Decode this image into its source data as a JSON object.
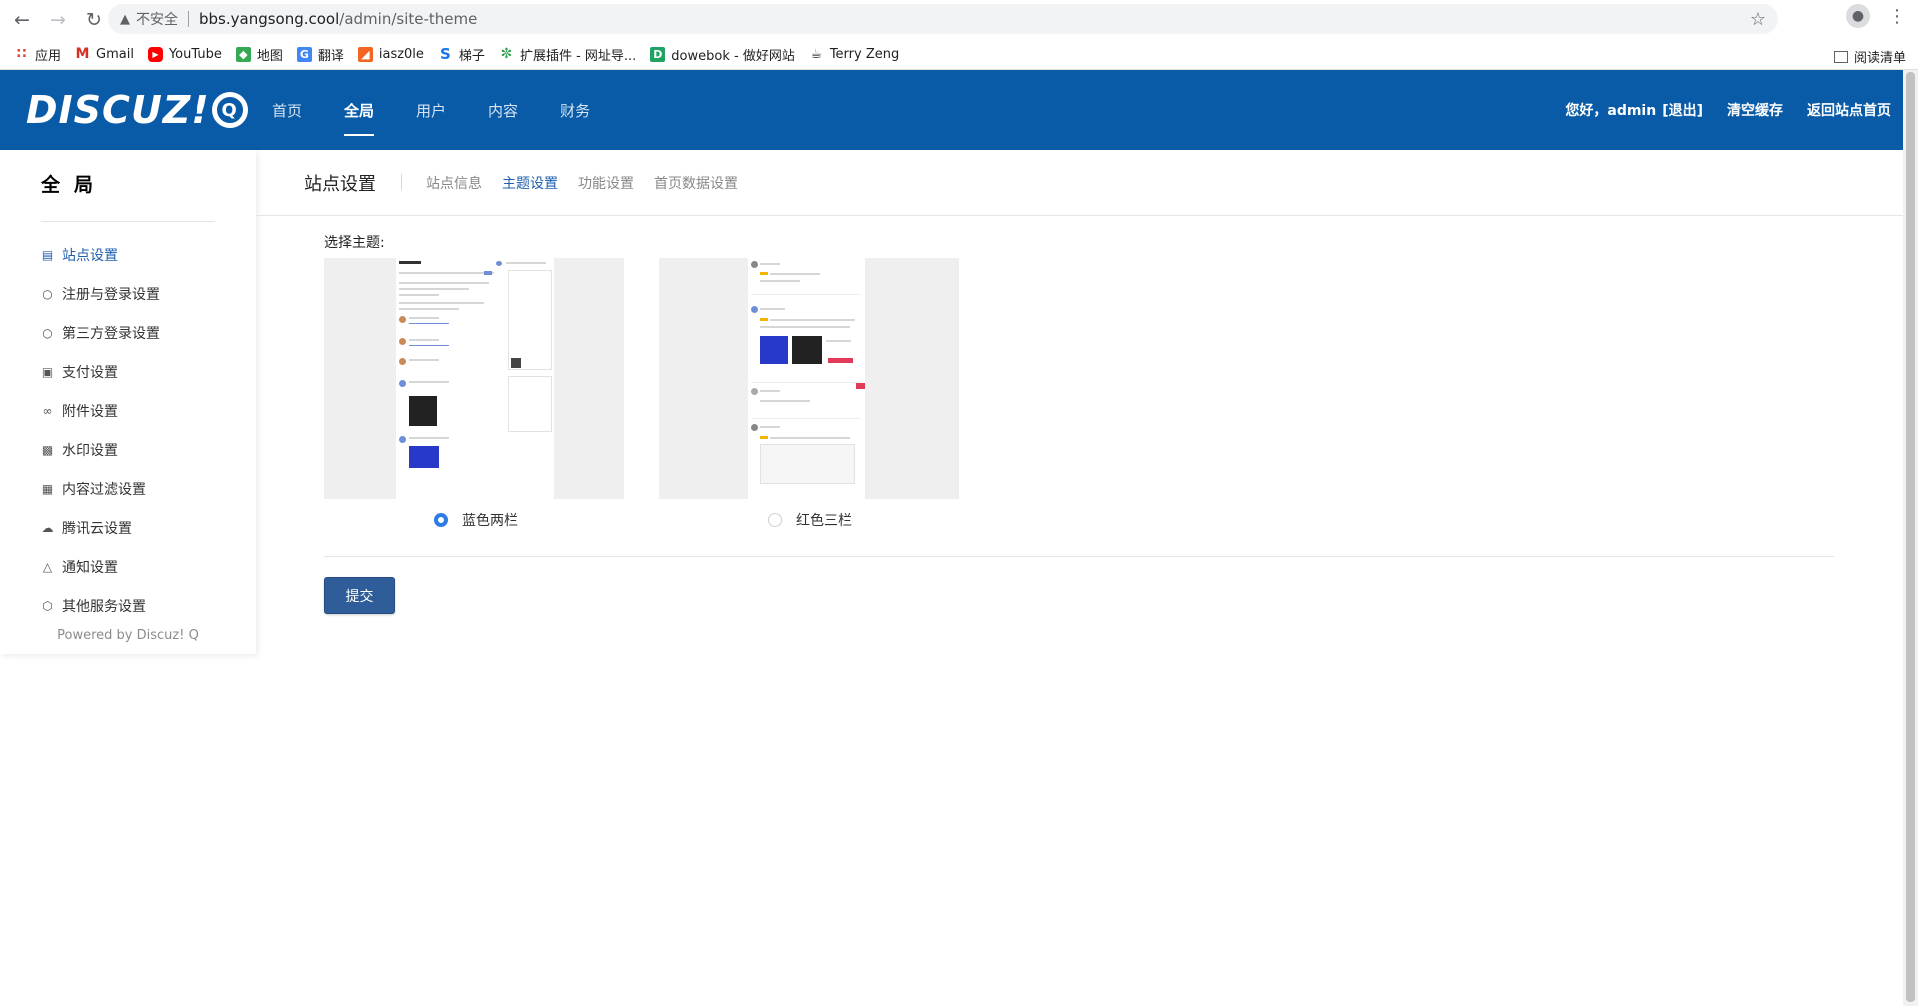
{
  "browser": {
    "insecure_label": "不安全",
    "url_host": "bbs.yangsong.cool",
    "url_path": "/admin/site-theme",
    "bookmarks": [
      {
        "label": "应用",
        "icon": "apps-grid-icon",
        "color": "#e94235"
      },
      {
        "label": "Gmail",
        "icon": "gmail-icon",
        "color": "#d93025"
      },
      {
        "label": "YouTube",
        "icon": "youtube-icon",
        "color": "#ff0000"
      },
      {
        "label": "地图",
        "icon": "maps-icon",
        "color": "#34a853"
      },
      {
        "label": "翻译",
        "icon": "translate-icon",
        "color": "#4285f4"
      },
      {
        "label": "iasz0le",
        "icon": "bookmark-orange-icon",
        "color": "#f26522"
      },
      {
        "label": "梯子",
        "icon": "s-logo-icon",
        "color": "#1a73e8"
      },
      {
        "label": "扩展插件 - 网址导...",
        "icon": "extension-green-icon",
        "color": "#2e9c4f"
      },
      {
        "label": "dowebok - 做好网站",
        "icon": "d-logo-icon",
        "color": "#1ea362"
      },
      {
        "label": "Terry Zeng",
        "icon": "coffee-cup-icon",
        "color": "#202124"
      }
    ],
    "reading_list": "阅读清单"
  },
  "header": {
    "logo_text": "DISCUZ!",
    "nav": [
      "首页",
      "全局",
      "用户",
      "内容",
      "财务"
    ],
    "active_nav": "全局",
    "greeting": "您好，admin",
    "logout": "[退出]",
    "clear_cache": "清空缓存",
    "back_home": "返回站点首页",
    "brand_color": "#0a5ba7"
  },
  "sidebar": {
    "title": "全局",
    "items": [
      {
        "label": "站点设置",
        "icon": "document-icon",
        "active": true
      },
      {
        "label": "注册与登录设置",
        "icon": "user-icon"
      },
      {
        "label": "第三方登录设置",
        "icon": "user-icon"
      },
      {
        "label": "支付设置",
        "icon": "wallet-icon"
      },
      {
        "label": "附件设置",
        "icon": "paperclip-icon"
      },
      {
        "label": "水印设置",
        "icon": "image-icon"
      },
      {
        "label": "内容过滤设置",
        "icon": "briefcase-icon"
      },
      {
        "label": "腾讯云设置",
        "icon": "cloud-icon"
      },
      {
        "label": "通知设置",
        "icon": "bell-icon"
      },
      {
        "label": "其他服务设置",
        "icon": "cube-icon"
      }
    ],
    "powered": "Powered by Discuz! Q"
  },
  "content": {
    "page_title": "站点设置",
    "tabs": [
      "站点信息",
      "主题设置",
      "功能设置",
      "首页数据设置"
    ],
    "active_tab": "主题设置",
    "choose_label": "选择主题:",
    "themes": [
      {
        "label": "蓝色两栏",
        "checked": true
      },
      {
        "label": "红色三栏",
        "checked": false
      }
    ],
    "submit": "提交"
  }
}
